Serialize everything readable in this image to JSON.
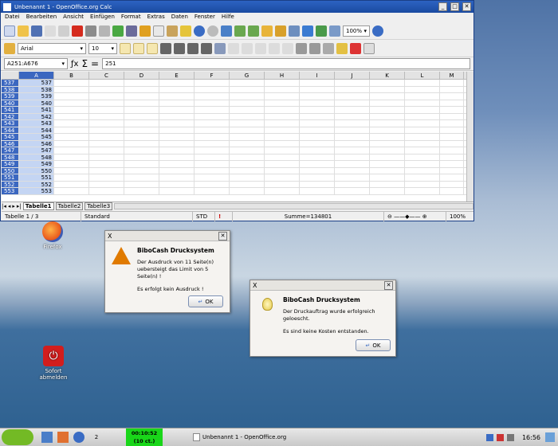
{
  "calc": {
    "title": "Unbenannt 1 - OpenOffice.org Calc",
    "menu": [
      "Datei",
      "Bearbeiten",
      "Ansicht",
      "Einfügen",
      "Format",
      "Extras",
      "Daten",
      "Fenster",
      "Hilfe"
    ],
    "zoom": "100%",
    "font_name": "Arial",
    "font_size": "10",
    "name_box": "A251:A676",
    "formula_value": "251",
    "columns": [
      "A",
      "B",
      "C",
      "D",
      "E",
      "F",
      "G",
      "H",
      "I",
      "J",
      "K",
      "L",
      "M"
    ],
    "rows": [
      {
        "num": "537",
        "val": "537"
      },
      {
        "num": "538",
        "val": "538"
      },
      {
        "num": "539",
        "val": "539"
      },
      {
        "num": "540",
        "val": "540"
      },
      {
        "num": "541",
        "val": "541"
      },
      {
        "num": "542",
        "val": "542"
      },
      {
        "num": "543",
        "val": "543"
      },
      {
        "num": "544",
        "val": "544"
      },
      {
        "num": "545",
        "val": "545"
      },
      {
        "num": "546",
        "val": "546"
      },
      {
        "num": "547",
        "val": "547"
      },
      {
        "num": "548",
        "val": "548"
      },
      {
        "num": "549",
        "val": "549"
      },
      {
        "num": "550",
        "val": "550"
      },
      {
        "num": "551",
        "val": "551"
      },
      {
        "num": "552",
        "val": "552"
      },
      {
        "num": "553",
        "val": "553"
      }
    ],
    "sheet_tabs": [
      "Tabelle1",
      "Tabelle2",
      "Tabelle3"
    ],
    "status": {
      "sheet": "Tabelle 1 / 3",
      "style": "Standard",
      "mode": "STD",
      "sum": "Summe=134801",
      "zoom": "100%"
    }
  },
  "desktop": {
    "firefox_label": "Firefox",
    "logout_label_1": "Sofort",
    "logout_label_2": "abmelden"
  },
  "dialog1": {
    "title_icon": "X",
    "heading": "BiboCash Drucksystem",
    "line1": "Der Ausdruck von 11 Seite(n)",
    "line2": "uebersteigt das Limit von 5 Seite(n) !",
    "line3": "Es erfolgt kein Ausdruck !",
    "ok": "OK"
  },
  "dialog2": {
    "title_icon": "X",
    "heading": "BiboCash Drucksystem",
    "line1": "Der Druckauftrag wurde erfolgreich geloescht.",
    "line2": "Es sind keine Kosten entstanden.",
    "ok": "OK"
  },
  "taskbar": {
    "pager": "2",
    "timer_1": "00:10:52",
    "timer_2": "(10 ct.)",
    "task": "Unbenannt 1 - OpenOffice.org",
    "clock": "16:56"
  }
}
